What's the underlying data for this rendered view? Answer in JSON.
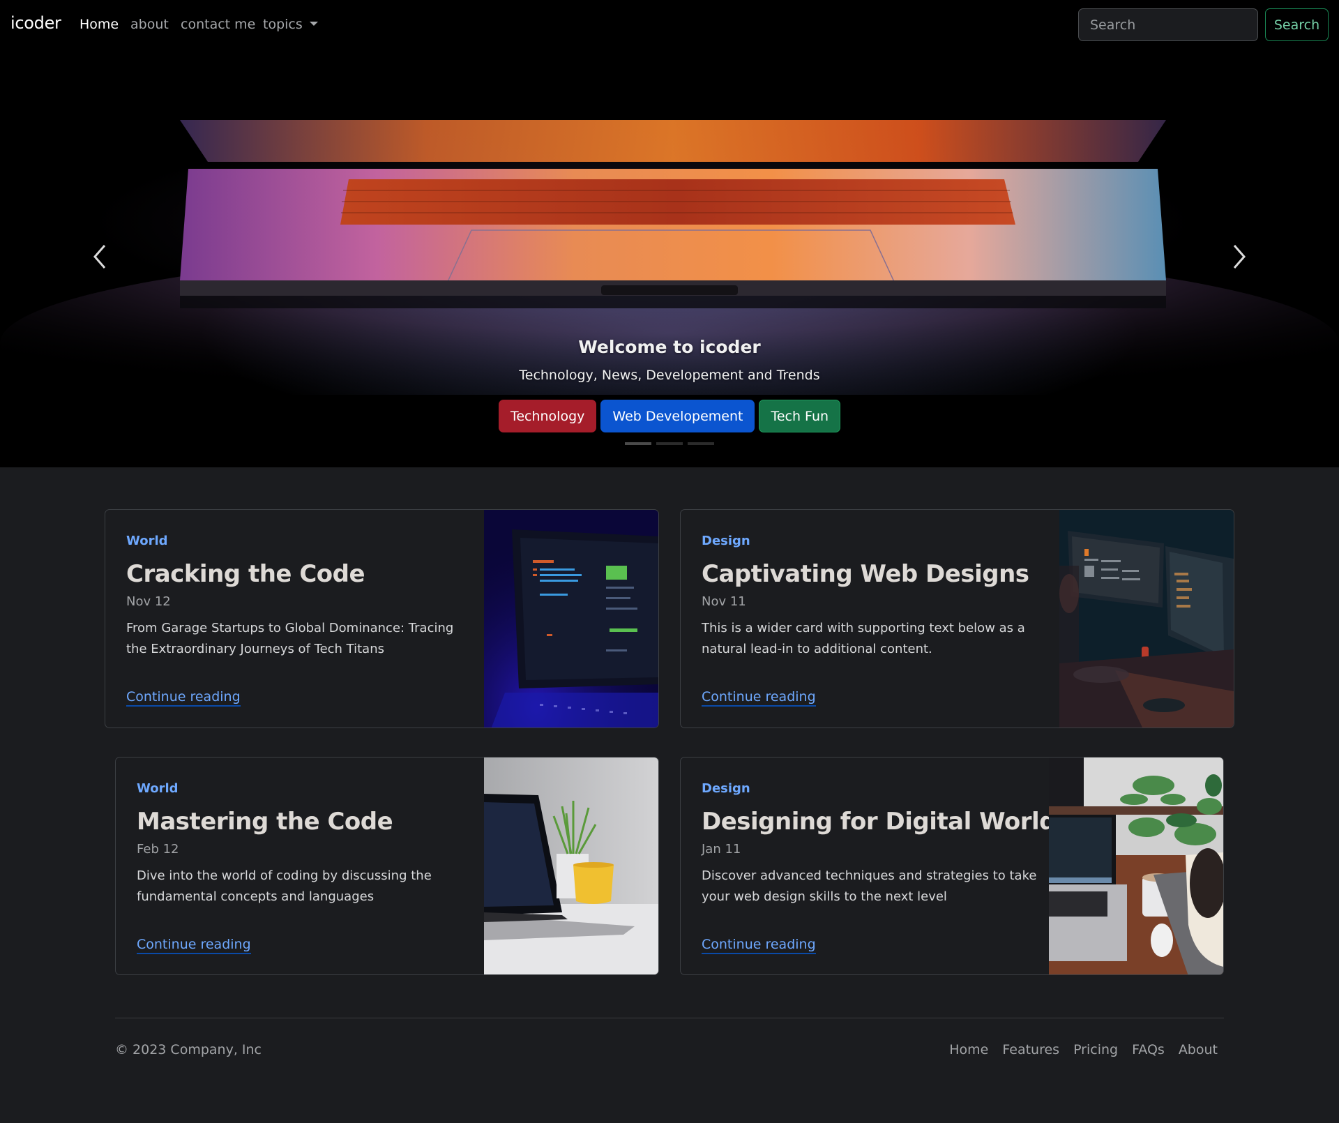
{
  "navbar": {
    "brand": "icoder",
    "links": [
      {
        "label": "Home",
        "active": true
      },
      {
        "label": "about",
        "active": false
      },
      {
        "label": "contact me",
        "active": false
      },
      {
        "label": "topics",
        "active": false,
        "dropdown": true
      }
    ],
    "search": {
      "placeholder": "Search",
      "value": "",
      "button_label": "Search"
    }
  },
  "hero": {
    "title": "Welcome to icoder",
    "subtitle": "Technology, News, Developement and Trends",
    "buttons": [
      {
        "label": "Technology",
        "color": "#a51d2a"
      },
      {
        "label": "Web Developement",
        "color": "#0b55d0"
      },
      {
        "label": "Tech Fun",
        "color": "#157347"
      }
    ],
    "prev_icon": "chevron-left-icon",
    "next_icon": "chevron-right-icon",
    "slides_total": 3,
    "active_slide": 1
  },
  "cards": [
    {
      "category": "World",
      "title": "Cracking the Code",
      "date": "Nov 12",
      "text": "From Garage Startups to Global Dominance: Tracing the Extraordinary Journeys of Tech Titans",
      "link": "Continue reading",
      "image": "laptop-code-blue"
    },
    {
      "category": "Design",
      "title": "Captivating Web Designs",
      "date": "Nov 11",
      "text": "This is a wider card with supporting text below as a natural lead-in to additional content.",
      "link": "Continue reading",
      "image": "developer-dual-monitors"
    },
    {
      "category": "World",
      "title": "Mastering the Code",
      "date": "Feb 12",
      "text": "Dive into the world of coding by discussing the fundamental concepts and languages",
      "link": "Continue reading",
      "image": "laptop-plant-yellow-cup"
    },
    {
      "category": "Design",
      "title": "Designing for Digital World",
      "date": "Jan 11",
      "text": "Discover advanced techniques and strategies to take your web design skills to the next level",
      "link": "Continue reading",
      "image": "desk-laptop-plants-coffee"
    }
  ],
  "footer": {
    "copyright": "© 2023 Company, Inc",
    "links": [
      "Home",
      "Features",
      "Pricing",
      "FAQs",
      "About"
    ]
  },
  "colors": {
    "accent_link": "#6ea8fe",
    "success_outline": "#198754",
    "page_bg": "#1b1c1f"
  }
}
